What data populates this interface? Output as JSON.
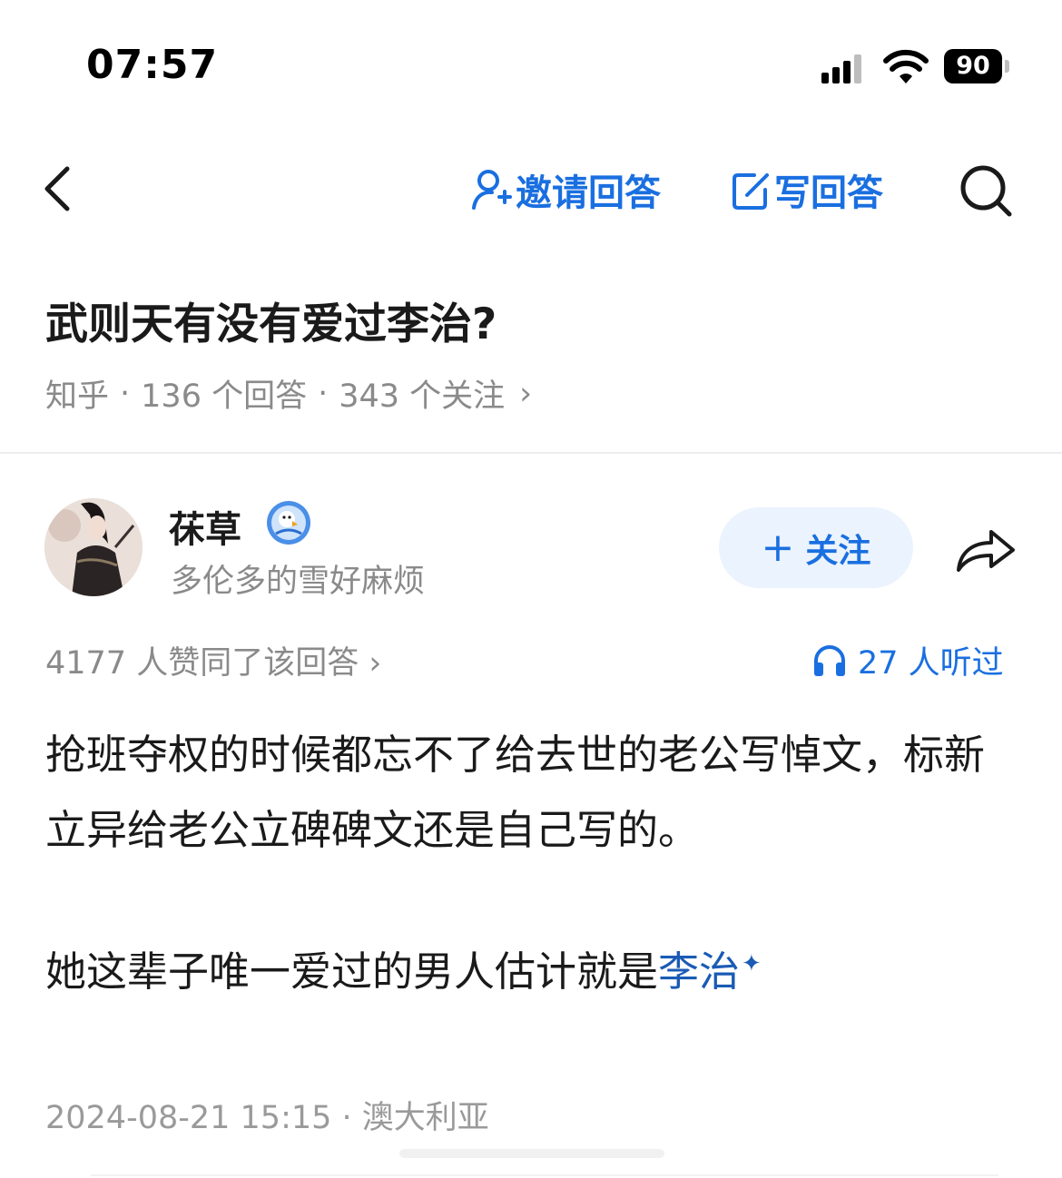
{
  "status_bar": {
    "time": "07:57",
    "battery": "90"
  },
  "nav": {
    "invite_label": "邀请回答",
    "write_label": "写回答"
  },
  "question": {
    "title": "武则天有没有爱过李治?",
    "source": "知乎",
    "answers": "136 个回答",
    "followers": "343 个关注",
    "separator": "·",
    "chevron": "›"
  },
  "author": {
    "name": "茠草",
    "bio": "多伦多的雪好麻烦",
    "follow_label": "关注",
    "follow_plus": "+"
  },
  "stats": {
    "votes": "4177 人赞同了该回答 ›",
    "listened": "27 人听过"
  },
  "answer": {
    "paragraph_1": "抢班夺权的时候都忘不了给去世的老公写悼文，标新立异给老公立碑碑文还是自己写的。",
    "paragraph_2_prefix": "她这辈子唯一爱过的男人估计就是",
    "paragraph_2_link": "李治",
    "link_mark": "✦"
  },
  "footer": {
    "meta": "2024-08-21 15:15 · 澳大利亚"
  },
  "colors": {
    "accent": "#1a6fe0",
    "link": "#1a5bb5",
    "muted": "#8a8a8a",
    "follow_bg": "#ebf3fe"
  },
  "icons": [
    "signal-icon",
    "wifi-icon",
    "battery-icon",
    "back-chevron-icon",
    "invite-user-icon",
    "edit-icon",
    "search-icon",
    "avatar",
    "verified-badge-icon",
    "plus-icon",
    "share-icon",
    "headphones-icon"
  ]
}
